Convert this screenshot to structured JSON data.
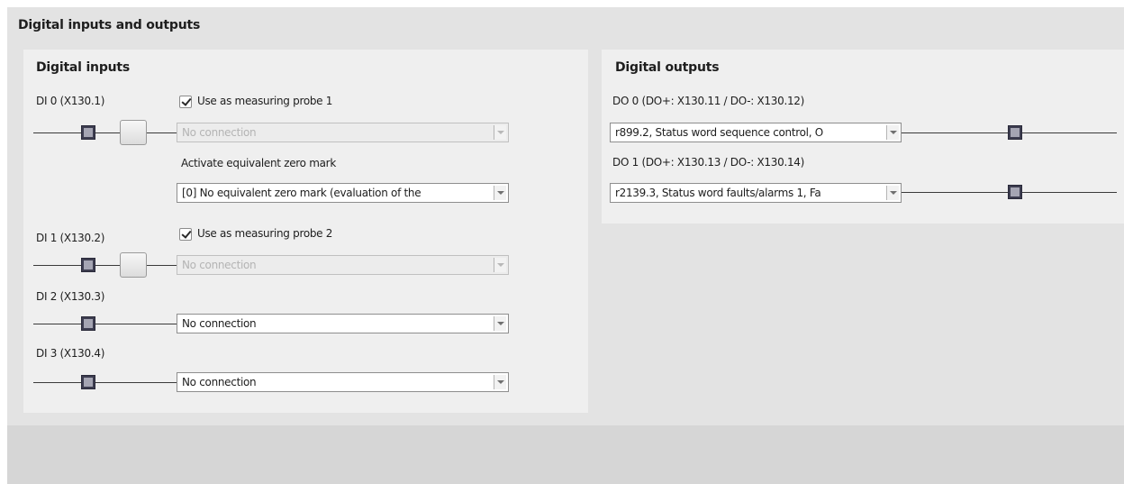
{
  "section": {
    "title": "Digital inputs and outputs"
  },
  "inputs": {
    "title": "Digital inputs",
    "di0": {
      "label": "DI 0 (X130.1)",
      "probe_label": "Use as measuring probe 1",
      "probe_checked": true,
      "select_value": "No connection",
      "zero_mark_label": "Activate equivalent zero mark",
      "zero_mark_value": "[0] No equivalent zero mark (evaluation of the"
    },
    "di1": {
      "label": "DI 1 (X130.2)",
      "probe_label": "Use as measuring probe 2",
      "probe_checked": true,
      "select_value": "No connection"
    },
    "di2": {
      "label": "DI 2 (X130.3)",
      "select_value": "No connection"
    },
    "di3": {
      "label": "DI 3 (X130.4)",
      "select_value": "No connection"
    }
  },
  "outputs": {
    "title": "Digital outputs",
    "do0": {
      "label": "DO 0 (DO+: X130.11 / DO-: X130.12)",
      "select_value": "r899.2, Status word sequence control, O"
    },
    "do1": {
      "label": "DO 1 (DO+: X130.13 / DO-: X130.14)",
      "select_value": "r2139.3, Status word faults/alarms 1, Fa"
    }
  }
}
